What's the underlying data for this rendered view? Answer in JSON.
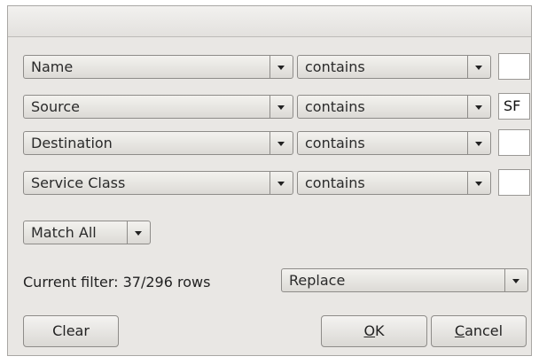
{
  "filters": [
    {
      "field": "Name",
      "operator": "contains",
      "value": ""
    },
    {
      "field": "Source",
      "operator": "contains",
      "value": "SF"
    },
    {
      "field": "Destination",
      "operator": "contains",
      "value": ""
    },
    {
      "field": "Service Class",
      "operator": "contains",
      "value": ""
    }
  ],
  "match_mode": "Match All",
  "status": {
    "text": "Current filter: 37/296 rows"
  },
  "apply_mode": "Replace",
  "buttons": {
    "clear": "Clear",
    "ok_mnemonic": "O",
    "ok_rest": "K",
    "cancel_mnemonic": "C",
    "cancel_rest": "ancel"
  },
  "icons": {
    "dropdown": "chevron-down-icon"
  }
}
